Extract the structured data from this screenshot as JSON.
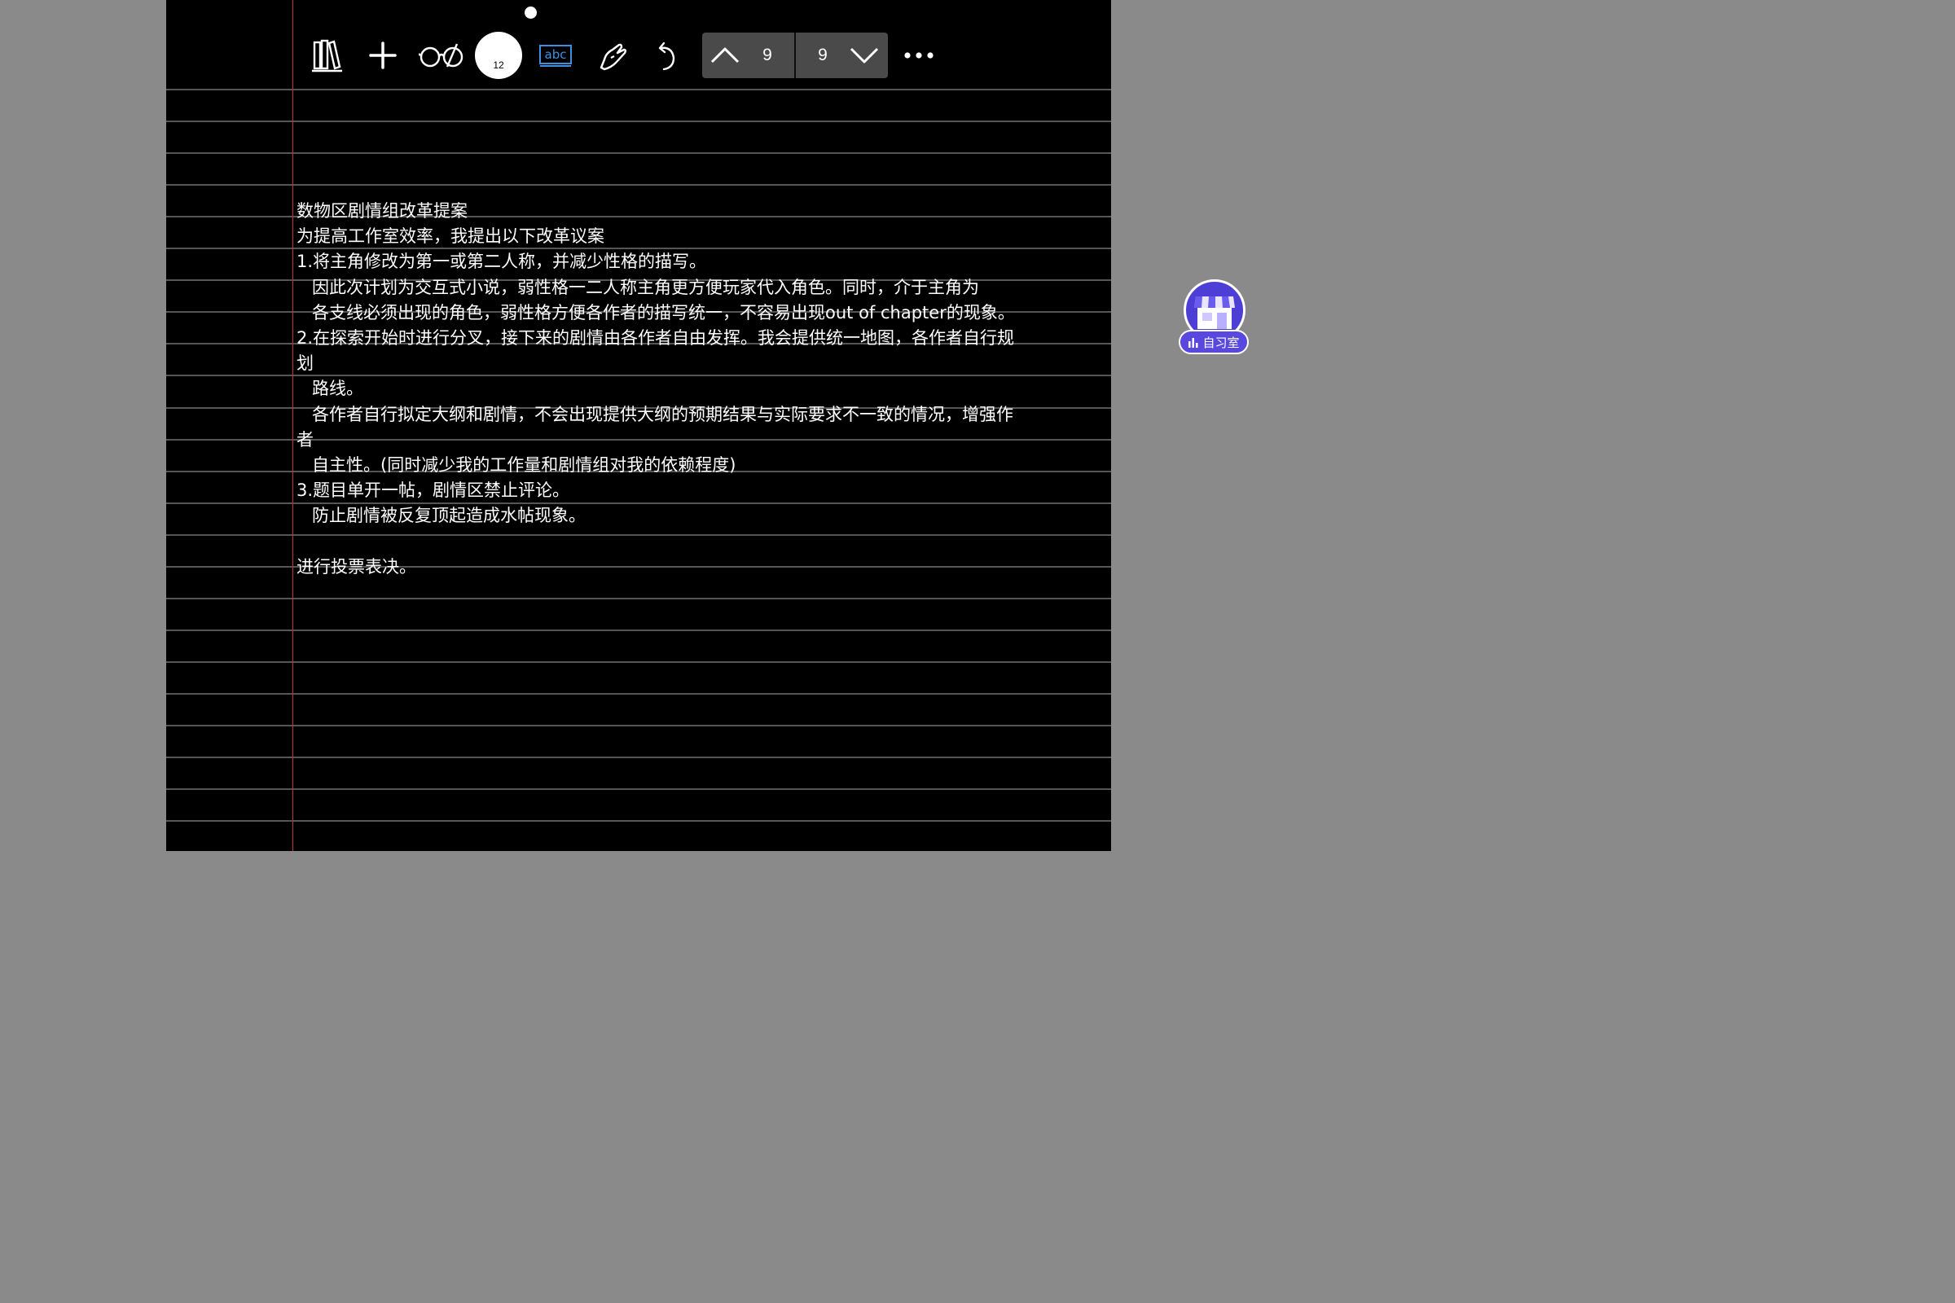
{
  "toolbar": {
    "icons": {
      "library": "books-icon",
      "add": "plus-icon",
      "reading_mode": "glasses-icon",
      "text_tool": "abc-text-icon",
      "lasso": "lasso-hand-icon",
      "undo": "undo-icon",
      "more": "more-dots-icon"
    },
    "pen_size": "12",
    "pager": {
      "current_page": "9",
      "total_pages": "9"
    }
  },
  "document": {
    "lines": [
      {
        "text": "数物区剧情组改革提案",
        "indent": false
      },
      {
        "text": "为提高工作室效率，我提出以下改革议案",
        "indent": false
      },
      {
        "text": "1.将主角修改为第一或第二人称，并减少性格的描写。",
        "indent": false
      },
      {
        "text": "因此次计划为交互式小说，弱性格一二人称主角更方便玩家代入角色。同时，介于主角为",
        "indent": true
      },
      {
        "text": "各支线必须出现的角色，弱性格方便各作者的描写统一，不容易出现out of chapter的现象。",
        "indent": true
      },
      {
        "text": "2.在探索开始时进行分叉，接下来的剧情由各作者自由发挥。我会提供统一地图，各作者自行规",
        "indent": false
      },
      {
        "text": "划",
        "indent": false
      },
      {
        "text": "路线。",
        "indent": true
      },
      {
        "text": "各作者自行拟定大纲和剧情，不会出现提供大纲的预期结果与实际要求不一致的情况，增强作",
        "indent": true
      },
      {
        "text": "者",
        "indent": false
      },
      {
        "text": "自主性。(同时减少我的工作量和剧情组对我的依赖程度)",
        "indent": true
      },
      {
        "text": "3.题目单开一帖，剧情区禁止评论。",
        "indent": false
      },
      {
        "text": "防止剧情被反复顶起造成水帖现象。",
        "indent": true
      },
      {
        "text": "",
        "indent": false
      },
      {
        "text": "进行投票表决。",
        "indent": false
      }
    ]
  },
  "widget": {
    "label": "自习室",
    "icon": "store-icon"
  },
  "colors": {
    "page_background": "#000000",
    "rule_line": "#555555",
    "margin_line": "#c8323c",
    "accent_blue": "#3f8fe0",
    "widget_purple": "#4d3fd6"
  }
}
